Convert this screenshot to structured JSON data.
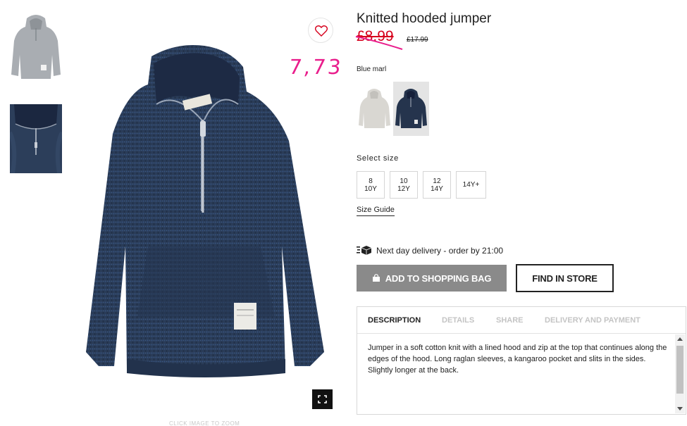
{
  "product": {
    "title": "Knitted hooded jumper",
    "sale_price": "£8.99",
    "original_price": "£17.99",
    "annotation": "7,73",
    "color_name": "Blue marl",
    "colors": {
      "accent": "#d6001c",
      "annotation": "#e91e8c",
      "navy": "#25344d"
    },
    "swatches": [
      {
        "name": "grey-hoodie-swatch"
      },
      {
        "name": "navy-hoodie-swatch",
        "selected": true
      }
    ]
  },
  "gallery": {
    "click_to_zoom": "CLICK IMAGE TO ZOOM",
    "favourite_icon": "heart-icon",
    "zoom_icon": "expand-icon"
  },
  "sizes": {
    "label": "Select size",
    "options": [
      {
        "line1": "8",
        "line2": "10Y"
      },
      {
        "line1": "10",
        "line2": "12Y"
      },
      {
        "line1": "12",
        "line2": "14Y"
      },
      {
        "line1": "14Y+",
        "line2": ""
      }
    ],
    "guide_label": "Size Guide"
  },
  "delivery": {
    "text": "Next day delivery - order by 21:00",
    "icon": "delivery-box-icon"
  },
  "actions": {
    "add_to_bag": "ADD TO SHOPPING BAG",
    "find_in_store": "FIND IN STORE",
    "bag_icon": "shopping-bag-icon"
  },
  "tabs": {
    "items": [
      "DESCRIPTION",
      "DETAILS",
      "SHARE",
      "DELIVERY AND PAYMENT"
    ],
    "active": "DESCRIPTION",
    "description": "Jumper in a soft cotton knit with a lined hood and zip at the top that continues along the edges of the hood. Long raglan sleeves, a kangaroo pocket and slits in the sides. Slightly longer at the back."
  }
}
